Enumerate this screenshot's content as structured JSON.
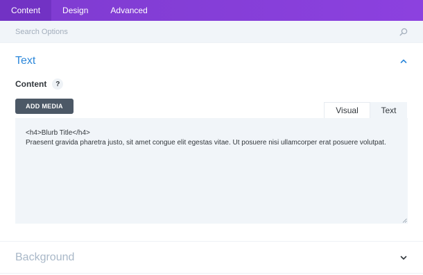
{
  "tabs": [
    {
      "label": "Content"
    },
    {
      "label": "Design"
    },
    {
      "label": "Advanced"
    }
  ],
  "search": {
    "placeholder": "Search Options"
  },
  "text_section": {
    "title": "Text",
    "field_label": "Content",
    "help_label": "?",
    "add_media_label": "ADD MEDIA",
    "editor_tabs": [
      {
        "label": "Visual"
      },
      {
        "label": "Text"
      }
    ],
    "editor_value": "<h4>Blurb Title</h4>\nPraesent gravida pharetra justo, sit amet congue elit egestas vitae. Ut posuere nisi ullamcorper erat posuere volutpat."
  },
  "background_section": {
    "title": "Background"
  },
  "colors": {
    "accent": "#2b87da",
    "tab_bar": "#8c41df",
    "muted_heading": "#a9b8c8",
    "button_dark": "#4c5866"
  },
  "icons": {
    "search": "search-icon",
    "collapse": "chevron-up-icon",
    "expand": "chevron-down-icon"
  }
}
